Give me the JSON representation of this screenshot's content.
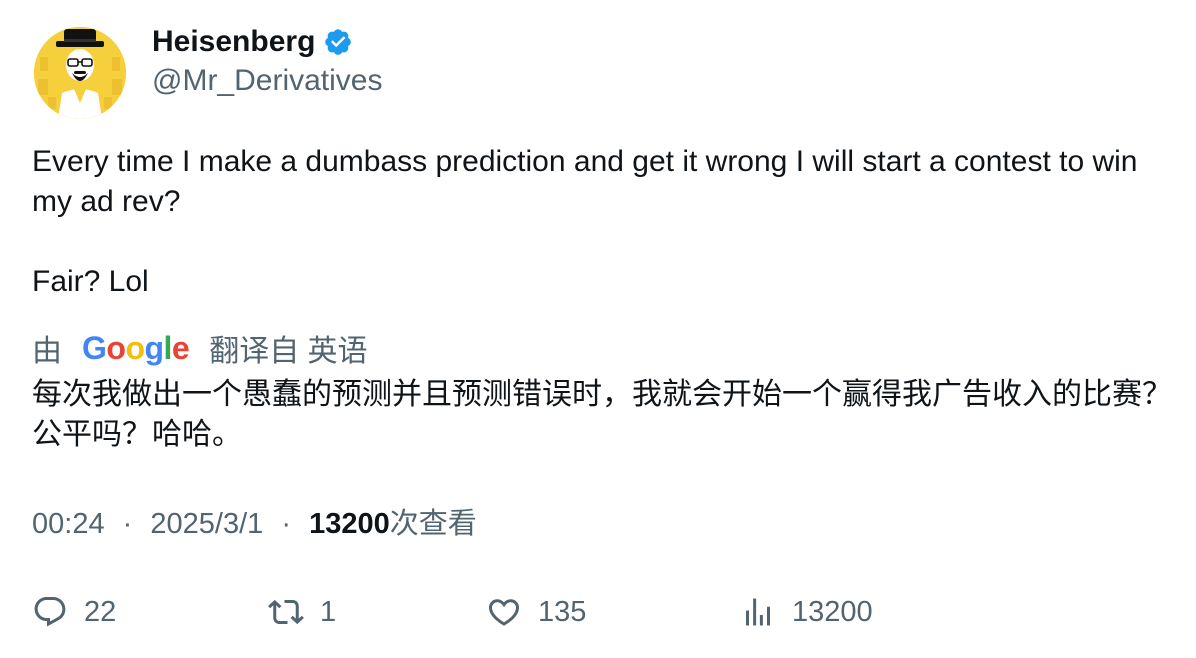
{
  "author": {
    "display_name": "Heisenberg",
    "handle": "@Mr_Derivatives",
    "verified": true,
    "avatar": "heisenberg-avatar"
  },
  "tweet": {
    "paragraph_1": "Every time I make a dumbass prediction and get it wrong I will start a contest to win my ad rev?",
    "paragraph_2": "Fair? Lol"
  },
  "translation": {
    "prefix": "由",
    "provider": "Google",
    "suffix": "翻译自 英语",
    "text": "每次我做出一个愚蠢的预测并且预测错误时，我就会开始一个赢得我广告收入的比赛？ 公平吗？哈哈。"
  },
  "meta": {
    "time": "00:24",
    "separator": "·",
    "date": "2025/3/1",
    "views": "13200",
    "views_label": "次查看"
  },
  "actions": {
    "replies": "22",
    "retweets": "1",
    "likes": "135",
    "views": "13200"
  },
  "colors": {
    "text": "#0f1419",
    "secondary": "#536471",
    "verified": "#1d9bf0",
    "google_blue": "#4285f4",
    "google_red": "#ea4335",
    "google_yellow": "#fbbc05",
    "google_green": "#34a853",
    "avatar_bg": "#f5cf3c"
  }
}
